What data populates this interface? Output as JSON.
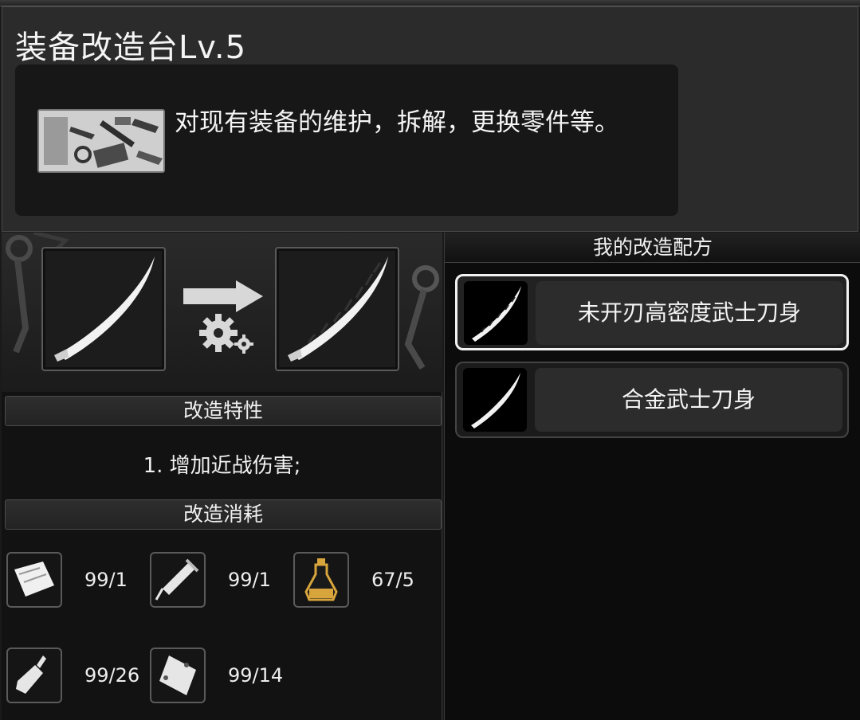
{
  "header": {
    "title": "装备改造台Lv.5",
    "description": "对现有装备的维护，拆解，更换零件等。"
  },
  "upgrade": {
    "source_icon": "katana-blade-icon",
    "target_icon": "serrated-blade-icon",
    "trait_section_label": "改造特性",
    "trait_text": "1. 增加近战伤害;",
    "cost_section_label": "改造消耗"
  },
  "materials": [
    {
      "icon": "cloth-icon",
      "count": "99/1"
    },
    {
      "icon": "syringe-icon",
      "count": "99/1"
    },
    {
      "icon": "potion-icon",
      "count": "67/5"
    },
    {
      "icon": "glue-tube-icon",
      "count": "99/26"
    },
    {
      "icon": "plate-icon",
      "count": "99/14"
    }
  ],
  "recipes": {
    "title": "我的改造配方",
    "items": [
      {
        "name": "未开刃高密度武士刀身",
        "selected": true
      },
      {
        "name": "合金武士刀身",
        "selected": false
      }
    ]
  },
  "colors": {
    "accent_gold": "#d8a53c",
    "panel_dark": "#121212"
  }
}
